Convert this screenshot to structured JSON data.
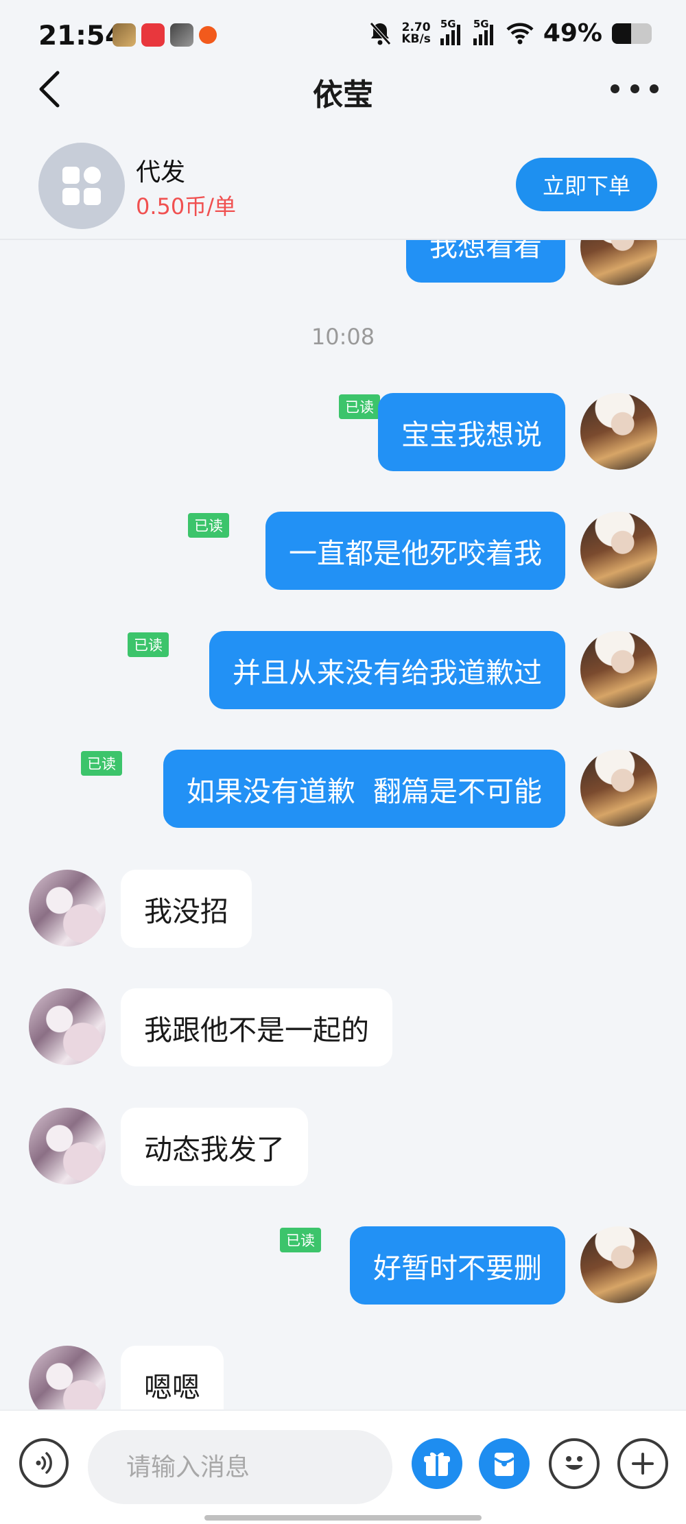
{
  "status_bar": {
    "time": "21:54",
    "net_speed_value": "2.70",
    "net_speed_unit": "KB/s",
    "sim1_label": "5G",
    "sim2_label": "5G",
    "battery_text": "49%",
    "battery_level": 0.49,
    "notification_icons": [
      "game-app-icon",
      "pinduoduo-icon",
      "avatar-app-icon",
      "orange-dot-app-icon"
    ]
  },
  "header": {
    "title": "依莹"
  },
  "service": {
    "name": "代发",
    "price": "0.50币/单",
    "order_button": "立即下单"
  },
  "messages": {
    "partial_top": "我想看看",
    "timestamp": "10:08",
    "m1": {
      "text": "宝宝我想说",
      "read": "已读"
    },
    "m2": {
      "text": "一直都是他死咬着我",
      "read": "已读"
    },
    "m3": {
      "text": "并且从来没有给我道歉过",
      "read": "已读"
    },
    "m4": {
      "text": "如果没有道歉  翻篇是不可能",
      "read": "已读"
    },
    "m5": {
      "text": "我没招"
    },
    "m6": {
      "text": "我跟他不是一起的"
    },
    "m7": {
      "text": "动态我发了"
    },
    "m8": {
      "text": "好暂时不要删",
      "read": "已读"
    },
    "m9": {
      "text": "嗯嗯"
    }
  },
  "input": {
    "placeholder": "请输入消息"
  },
  "colors": {
    "accent": "#1e90f0",
    "outgoing_bubble": "#2291f5",
    "read_badge": "#3cc46b",
    "price": "#f05050"
  }
}
